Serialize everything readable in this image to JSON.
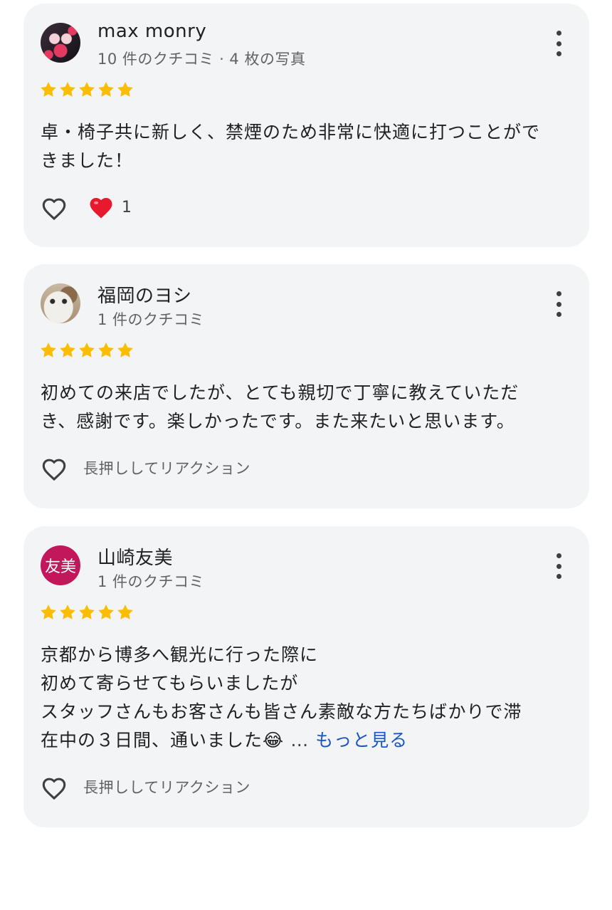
{
  "colors": {
    "card_bg": "#f2f4f6",
    "star": "#fbbc04",
    "link": "#1a57c4",
    "secondary_text": "#5f6368",
    "avatar_initial_bg": "#c2185b",
    "heart_red": "#e8192c"
  },
  "reviews": [
    {
      "name": "max monry",
      "meta": "10 件のクチコミ · 4 枚の写真",
      "rating": 5,
      "text_lines": [
        "卓・椅子共に新しく、禁煙のため非常に快適に打つことがで",
        "きました！"
      ],
      "reaction_count": "1",
      "avatar_icon": "anime-avatar-image"
    },
    {
      "name": "福岡のヨシ",
      "meta": "1 件のクチコミ",
      "rating": 5,
      "text_lines": [
        "初めての来店でしたが、とても親切で丁寧に教えていただ",
        "き、感謝です。楽しかったです。また来たいと思います。"
      ],
      "reaction_hint": "長押ししてリアクション",
      "avatar_icon": "cat-photo-avatar"
    },
    {
      "name": "山崎友美",
      "meta": "1 件のクチコミ",
      "rating": 5,
      "avatar_initial": "友美",
      "text_lines": [
        "京都から博多へ観光に行った際に",
        "初めて寄らせてもらいましたが",
        "スタッフさんもお客さんも皆さん素敵な方たちばかりで滞",
        "在中の３日間、通いました"
      ],
      "emoji": "😂",
      "ellipsis": "…",
      "see_more": "もっと見る",
      "reaction_hint": "長押ししてリアクション"
    }
  ]
}
